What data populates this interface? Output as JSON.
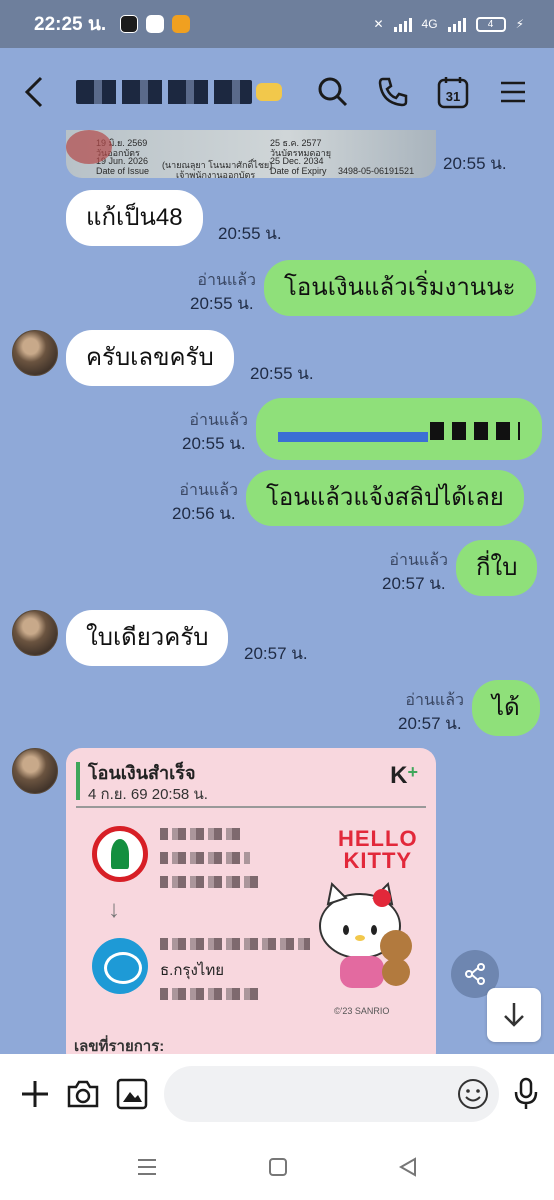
{
  "status_bar": {
    "time": "22:25 น.",
    "network": "4G",
    "battery": "4"
  },
  "header": {
    "contact_name": "▀▀ ▀ ▀▀▀ ▀"
  },
  "messages": [
    {
      "id": "m1",
      "side": "received",
      "text": "แก้เป็น48",
      "time": "20:55 น."
    },
    {
      "id": "m2",
      "side": "sent",
      "text": "โอนเงินแล้วเริ่มงานนะ",
      "read": "อ่านแล้ว",
      "time": "20:55 น."
    },
    {
      "id": "m3",
      "side": "received",
      "text": "ครับเลขครับ",
      "time": "20:55 น."
    },
    {
      "id": "m4",
      "side": "sent",
      "text": "",
      "read": "อ่านแล้ว",
      "time": "20:55 น."
    },
    {
      "id": "m5",
      "side": "sent",
      "text": "โอนแล้วแจ้งสลิปได้เลย",
      "read": "อ่านแล้ว",
      "time": "20:56 น."
    },
    {
      "id": "m6",
      "side": "sent",
      "text": "กี่ใบ",
      "read": "อ่านแล้ว",
      "time": "20:57 น."
    },
    {
      "id": "m7",
      "side": "received",
      "text": "ใบเดียวครับ",
      "time": "20:57 น."
    },
    {
      "id": "m8",
      "side": "sent",
      "text": "ได้",
      "read": "อ่านแล้ว",
      "time": "20:57 น."
    }
  ],
  "id_card": {
    "time": "20:55 น.",
    "issue_th": "19 มิ.ย. 2569",
    "issue_label_th": "วันออกบัตร",
    "issue_en": "19 Jun. 2026",
    "issue_label_en": "Date of Issue",
    "officer": "(นายณลุยา  โนนมาศักดิ์ไชย)",
    "officer_title": "เจ้าพนักงานออกบัตร",
    "expiry_th": "25 ธ.ค. 2577",
    "expiry_label_th": "วันบัตรหมดอายุ",
    "expiry_en": "25 Dec. 2034",
    "expiry_label_en": "Date of Expiry",
    "card_number": "3498-05-06191521"
  },
  "slip": {
    "title": "โอนเงินสำเร็จ",
    "date": "4 ก.ย. 69  20:58 น.",
    "brand": "K",
    "brand_plus": "+",
    "receiver_bank": "ธ.กรุงไทย",
    "ref_label": "เลขที่รายการ:",
    "kitty_line1": "HELLO",
    "kitty_line2": "KITTY",
    "copyright": "©'23 SANRIO"
  },
  "input": {
    "placeholder": ""
  }
}
